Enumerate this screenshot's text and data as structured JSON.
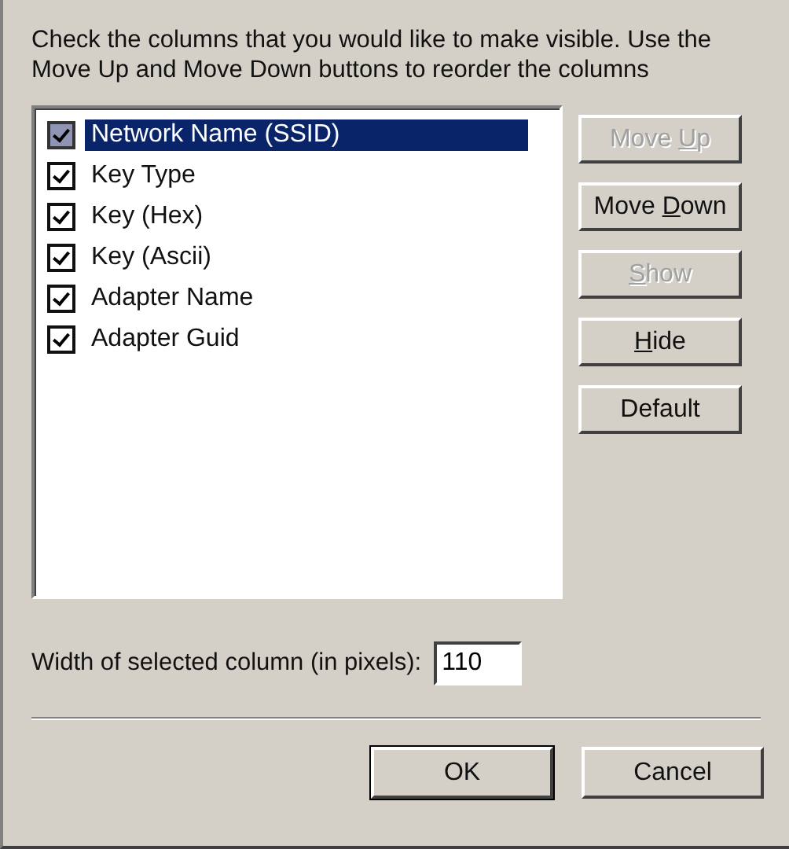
{
  "instructions": "Check the columns that you would like to make visible. Use the Move Up and Move Down buttons to reorder the columns",
  "columns": [
    {
      "label": "Network Name (SSID)",
      "checked": true,
      "selected": true
    },
    {
      "label": "Key Type",
      "checked": true,
      "selected": false
    },
    {
      "label": "Key (Hex)",
      "checked": true,
      "selected": false
    },
    {
      "label": "Key (Ascii)",
      "checked": true,
      "selected": false
    },
    {
      "label": "Adapter Name",
      "checked": true,
      "selected": false
    },
    {
      "label": "Adapter Guid",
      "checked": true,
      "selected": false
    }
  ],
  "side_buttons": [
    {
      "label_start": "Move ",
      "access_key": "U",
      "label_end": "p",
      "disabled": true
    },
    {
      "label_start": "Move ",
      "access_key": "D",
      "label_end": "own",
      "disabled": false
    },
    {
      "access_key": "S",
      "label_end": "how",
      "disabled": true
    },
    {
      "access_key": "H",
      "label_end": "ide",
      "disabled": false
    },
    {
      "label_start": "Default",
      "disabled": false
    }
  ],
  "width_field": {
    "label": "Width of selected column (in pixels):",
    "value": "110"
  },
  "dialog_buttons": [
    {
      "label": "OK",
      "default": true
    },
    {
      "label": "Cancel",
      "default": false
    }
  ]
}
